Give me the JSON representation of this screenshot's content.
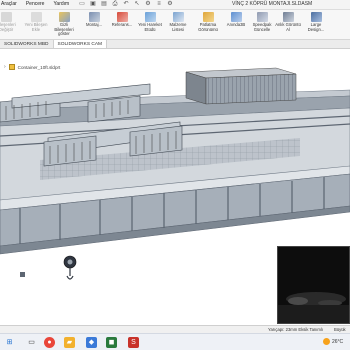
{
  "window": {
    "title": "VİNÇ 2 KÖPRÜ MONTAJI.SLDASM",
    "menu": [
      "Araçlar",
      "Pencere",
      "Yardım"
    ]
  },
  "ribbon": {
    "items": [
      {
        "label": "Bileşenleri Değiştir",
        "enabled": false
      },
      {
        "label": "Yeni Bileşen Ekle",
        "enabled": false
      },
      {
        "label": "Gizli Bileşenleri göster",
        "enabled": true
      },
      {
        "label": "Montaj...",
        "enabled": true
      },
      {
        "label": "Referans...",
        "enabled": true
      },
      {
        "label": "Yeni Hareket Etüdü",
        "enabled": true
      },
      {
        "label": "Malzeme Listesi",
        "enabled": true
      },
      {
        "label": "Patlatma Görünümü",
        "enabled": true
      },
      {
        "label": "Anında3B",
        "enabled": true
      },
      {
        "label": "Speedpak Güncelle",
        "enabled": true
      },
      {
        "label": "Anlık Görüntü Al",
        "enabled": true
      },
      {
        "label": "Large Design...",
        "enabled": true
      }
    ]
  },
  "tabs": [
    {
      "label": "SOLIDWORKS MBD",
      "active": false
    },
    {
      "label": "SOLIDWORKS CAM",
      "active": true
    }
  ],
  "breadcrumb": {
    "label": "Container_10ft.sldprt"
  },
  "status": {
    "edit_text": "Yarıçapı: 23mm   Eksik Tanımlı",
    "right_text": "Büyük"
  },
  "taskbar": {
    "temperature": "26°C"
  },
  "colors": {
    "steel": "#a9b1bb",
    "steel_dark": "#6f7985",
    "container": "#9da3aa",
    "window_bg": "#ffffff",
    "ribbon_bg": "#f7f7f7"
  }
}
